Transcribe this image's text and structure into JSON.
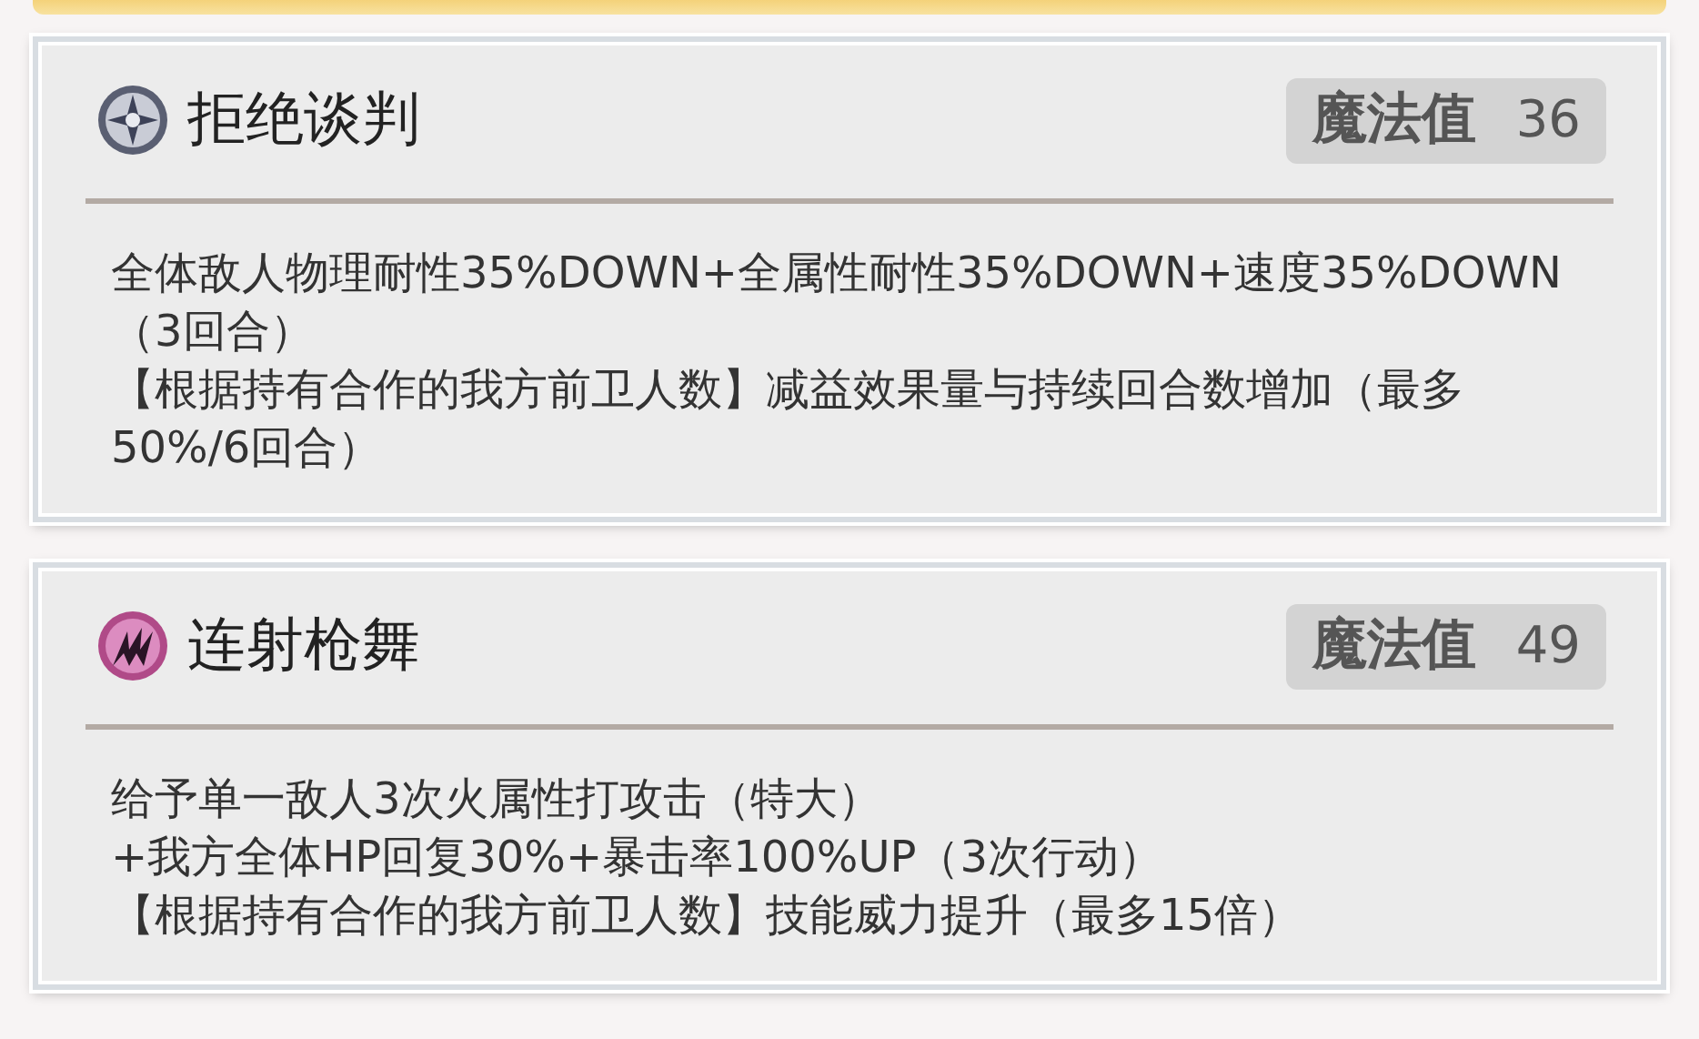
{
  "skills": [
    {
      "name": "拒绝谈判",
      "cost_label": "魔法值",
      "cost": "36",
      "description": [
        "全体敌人物理耐性35%DOWN+全属性耐性35%DOWN+速度35%DOWN（3回合）",
        "【根据持有合作的我方前卫人数】减益效果量与持续回合数增加（最多50%/6回合）"
      ]
    },
    {
      "name": "连射枪舞",
      "cost_label": "魔法值",
      "cost": "49",
      "description": [
        "给予单一敌人3次火属性打攻击（特大）",
        "+我方全体HP回复30%+暴击率100%UP（3次行动）",
        "【根据持有合作的我方前卫人数】技能威力提升（最多15倍）"
      ]
    }
  ]
}
